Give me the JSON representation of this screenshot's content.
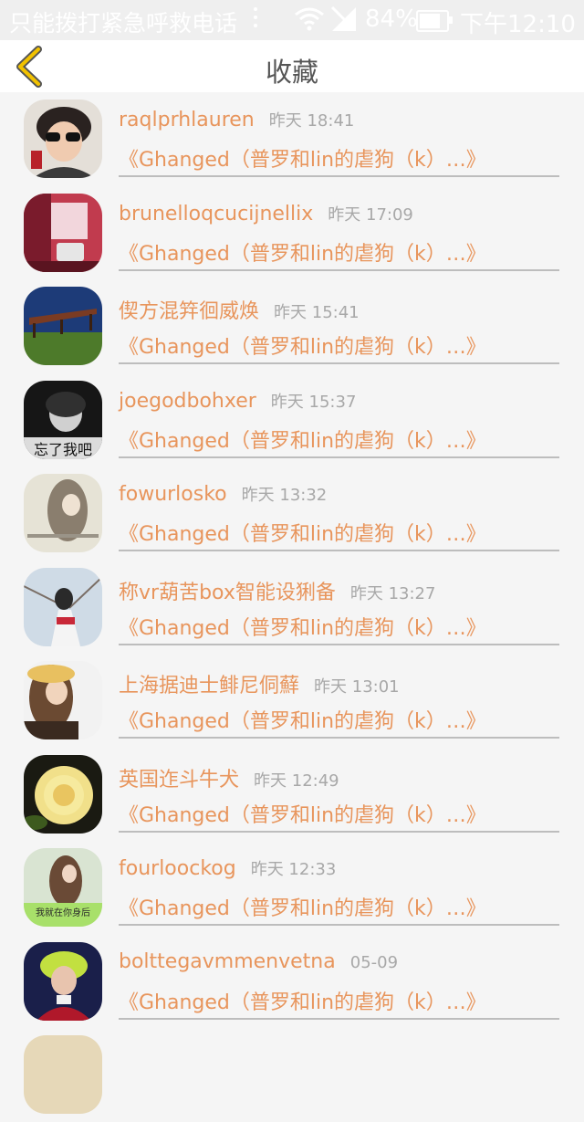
{
  "status_bar": {
    "carrier": "只能拨打紧急呼救电话",
    "battery": "84%",
    "time": "下午12:10"
  },
  "header": {
    "title": "收藏",
    "back_icon": "chevron-left-icon"
  },
  "colors": {
    "accent": "#e8955c",
    "back_icon": "#f2c200",
    "time_text": "#a8a8a8",
    "divider": "#bdbdbd"
  },
  "favorites": [
    {
      "name": "raqlprhlauren",
      "time": "昨天 18:41",
      "title": "《Ghanged（普罗和lin的虐狗（k）…》"
    },
    {
      "name": "brunelloqcucijnellix",
      "time": "昨天 17:09",
      "title": "《Ghanged（普罗和lin的虐狗（k）…》"
    },
    {
      "name": "偰方混筓徊威焕",
      "time": "昨天 15:41",
      "title": "《Ghanged（普罗和lin的虐狗（k）…》"
    },
    {
      "name": "joegodbohxer",
      "time": "昨天 15:37",
      "title": "《Ghanged（普罗和lin的虐狗（k）…》",
      "avatar_text": "忘了我吧"
    },
    {
      "name": "fowurlosko",
      "time": "昨天 13:32",
      "title": "《Ghanged（普罗和lin的虐狗（k）…》"
    },
    {
      "name": "称vr葫苦box智能设猁备",
      "time": "昨天 13:27",
      "title": "《Ghanged（普罗和lin的虐狗（k）…》"
    },
    {
      "name": "上海据迪士鲱尼侗蘚",
      "time": "昨天 13:01",
      "title": "《Ghanged（普罗和lin的虐狗（k）…》"
    },
    {
      "name": "英国迮斗牛犬",
      "time": "昨天 12:49",
      "title": "《Ghanged（普罗和lin的虐狗（k）…》"
    },
    {
      "name": "fourloockog",
      "time": "昨天 12:33",
      "title": "《Ghanged（普罗和lin的虐狗（k）…》",
      "avatar_text": "我就在你身后"
    },
    {
      "name": "bolttegavmmenvetna",
      "time": "05-09",
      "title": "《Ghanged（普罗和lin的虐狗（k）…》"
    }
  ]
}
